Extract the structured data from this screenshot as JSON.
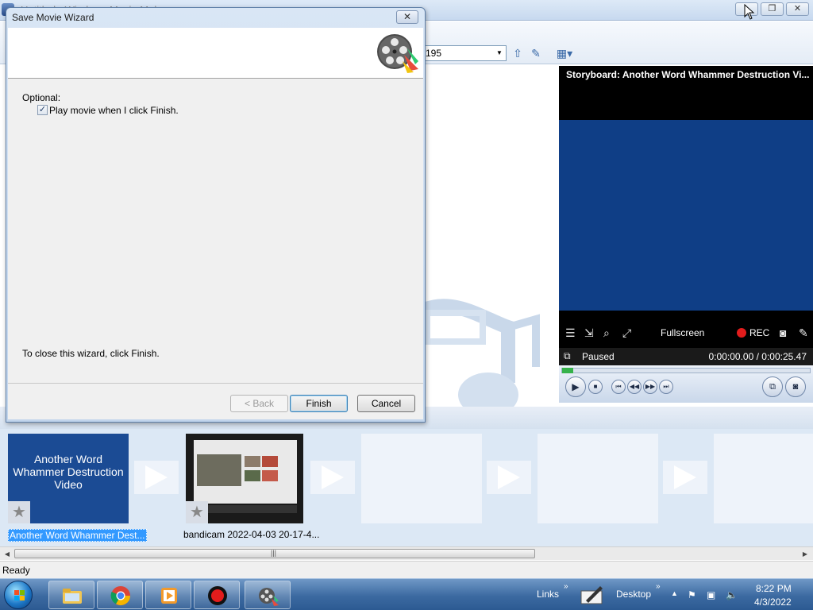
{
  "background_window": {
    "title": "Untitled - Windows Movie Maker",
    "toolbar_combo_value": "195",
    "status": "Ready"
  },
  "monitor": {
    "title": "Storyboard: Another Word Whammer Destruction Vi...",
    "fullscreen_label": "Fullscreen",
    "rec_label": "REC",
    "state": "Paused",
    "timecode": "0:00:00.00 / 0:00:25.47"
  },
  "storyboard": {
    "clips": [
      {
        "card_text": "Another Word Whammer Destruction Video",
        "label": "Another Word Whammer Dest..."
      },
      {
        "label": "bandicam 2022-04-03 20-17-4..."
      }
    ]
  },
  "dialog": {
    "title": "Save Movie Wizard",
    "optional_label": "Optional:",
    "play_checkbox_label": "Play movie when I click Finish.",
    "play_checked": true,
    "close_hint": "To close this wizard, click Finish.",
    "back_label": "< Back",
    "finish_label": "Finish",
    "cancel_label": "Cancel"
  },
  "taskbar": {
    "links_label": "Links",
    "desktop_label": "Desktop",
    "time": "8:22 PM",
    "date": "4/3/2022"
  },
  "colors": {
    "taskbar": "#3c6aa1",
    "title_card": "#1b4b94",
    "monitor_screen": "#0f3e86",
    "rec": "#e21c1c",
    "selection": "#3399ff"
  }
}
